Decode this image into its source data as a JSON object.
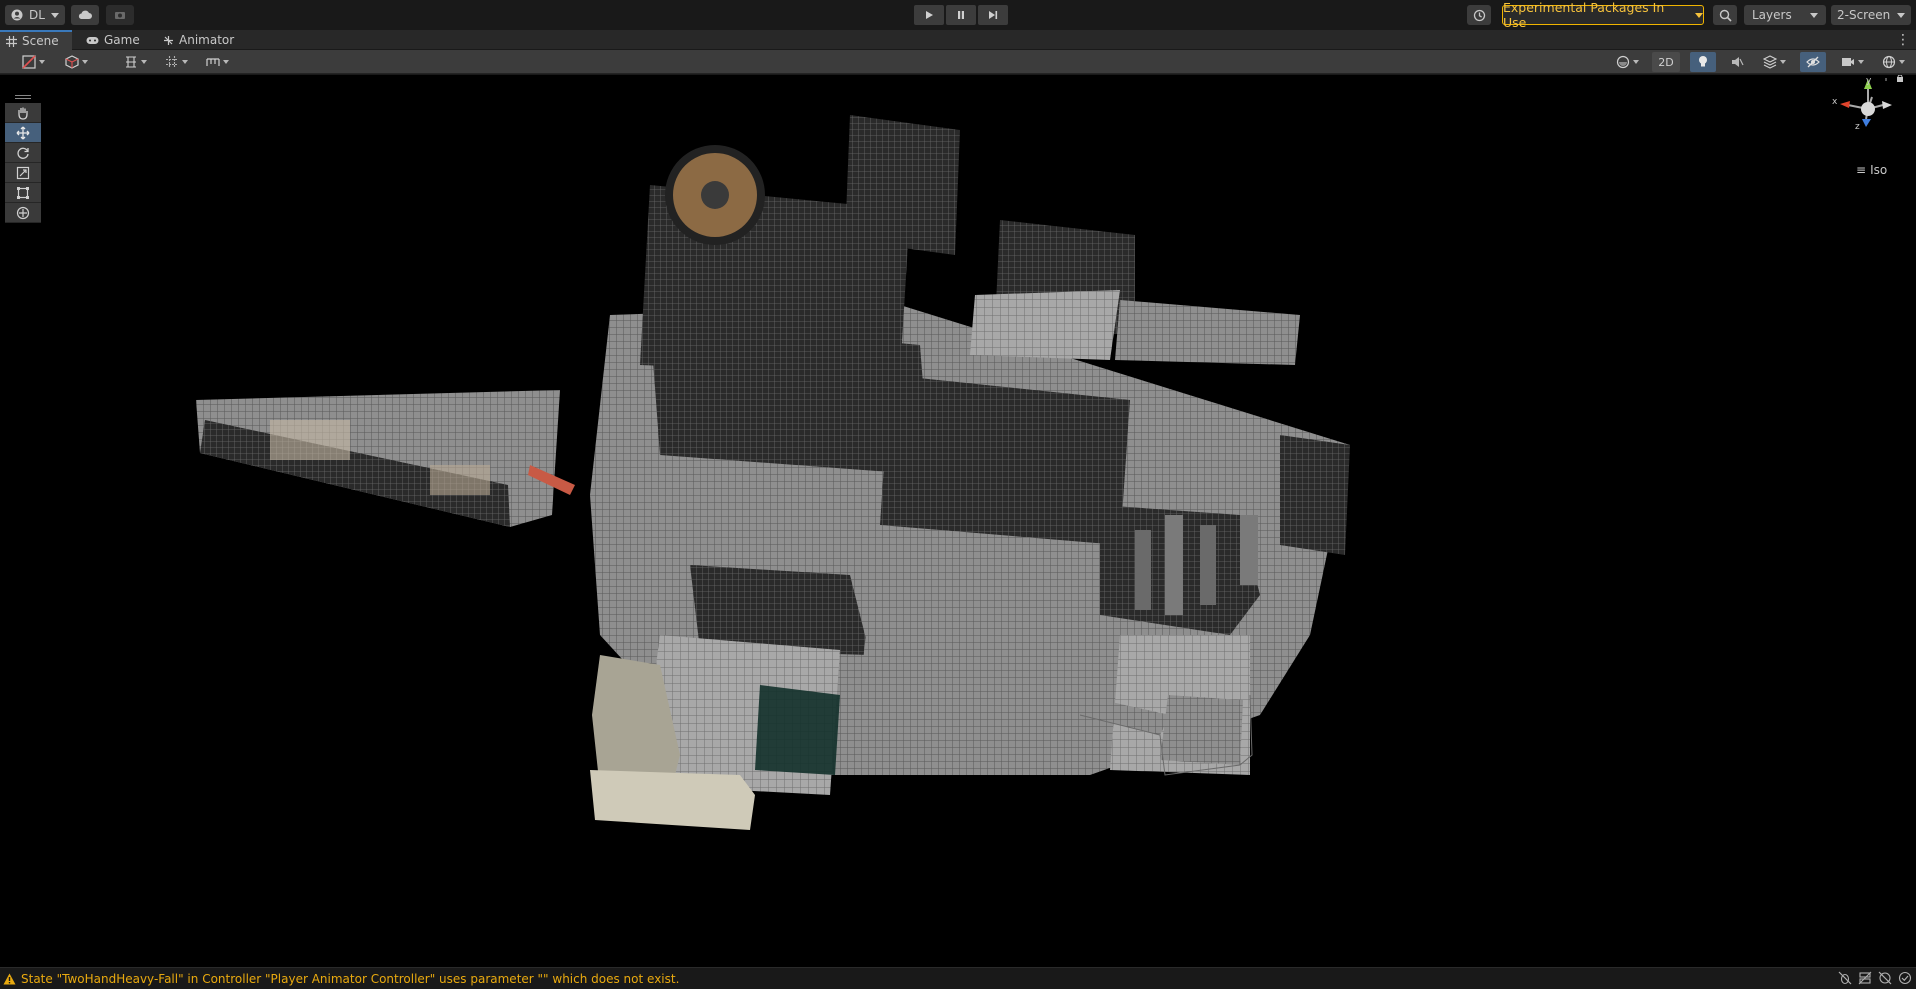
{
  "toolbar": {
    "account_label": "DL",
    "experimental_label": "Experimental Packages In Use",
    "layers_label": "Layers",
    "layout_label": "2-Screen"
  },
  "tabs": [
    {
      "label": "Scene",
      "icon": "grid-icon",
      "active": true
    },
    {
      "label": "Game",
      "icon": "gamepad-icon",
      "active": false
    },
    {
      "label": "Animator",
      "icon": "animator-icon",
      "active": false
    }
  ],
  "scene_toolbar": {
    "mode_2d_label": "2D"
  },
  "tools": [
    "hand-tool",
    "move-tool",
    "rotate-tool",
    "scale-tool",
    "rect-tool",
    "transform-tool"
  ],
  "active_tool": "move-tool",
  "gizmo": {
    "axis_x": "x",
    "axis_y": "y",
    "axis_z": "z",
    "projection_label": "Iso"
  },
  "status": {
    "message": "State \"TwoHandHeavy-Fall\" in Controller \"Player Animator Controller\" uses parameter \"\" which does not exist."
  },
  "colors": {
    "accent": "#3a79bb",
    "warning": "#e8a90f",
    "experimental_border": "#f0b400"
  }
}
